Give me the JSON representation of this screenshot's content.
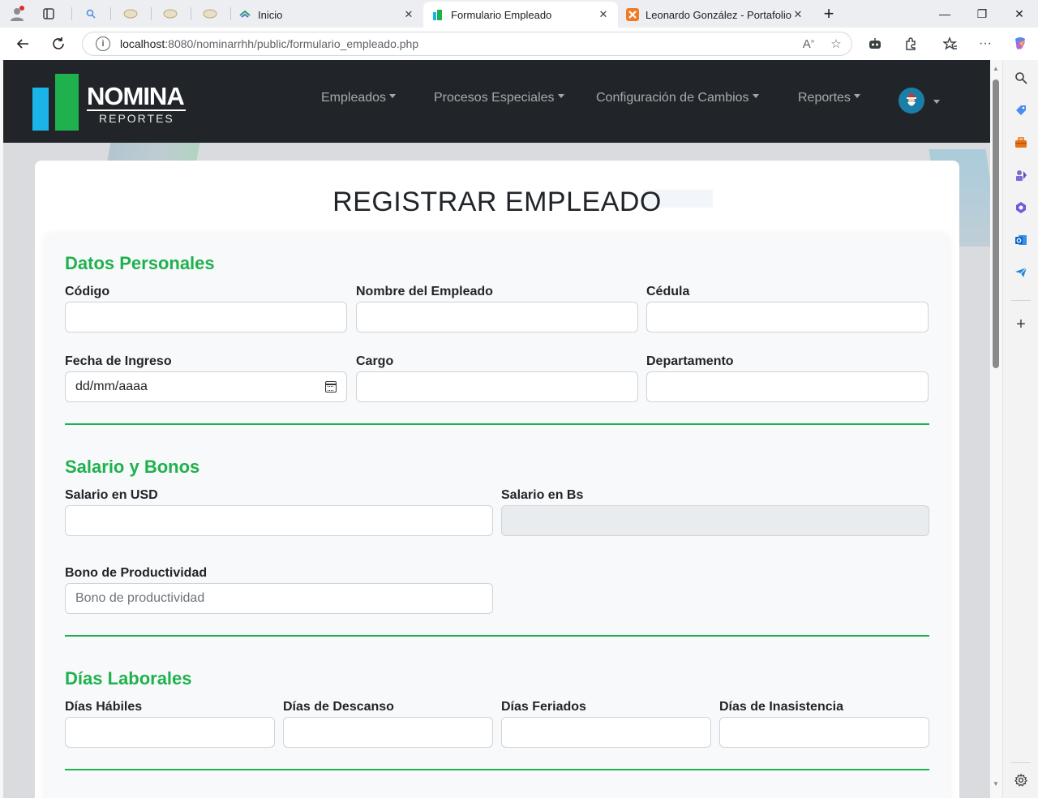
{
  "browser": {
    "tabs": [
      {
        "title": "Inicio",
        "active": false
      },
      {
        "title": "Formulario Empleado",
        "active": true
      },
      {
        "title": "Leonardo González - Portafolio",
        "active": false
      }
    ],
    "new_tab": "+",
    "url_host": "localhost",
    "url_rest": ":8080/nominarrhh/public/formulario_empleado.php",
    "window_controls": {
      "minimize": "—",
      "restore": "❐",
      "close": "✕"
    }
  },
  "navbar": {
    "logo_title": "NOMINA",
    "logo_subtitle": "REPORTES",
    "items": [
      {
        "label": "Empleados"
      },
      {
        "label": "Procesos Especiales"
      },
      {
        "label": "Configuración de Cambios"
      },
      {
        "label": "Reportes"
      }
    ]
  },
  "form": {
    "title": "REGISTRAR EMPLEADO",
    "sections": {
      "personal": {
        "title": "Datos Personales",
        "codigo": "Código",
        "nombre": "Nombre del Empleado",
        "cedula": "Cédula",
        "fecha": "Fecha de Ingreso",
        "fecha_placeholder": "dd/mm/aaaa",
        "cargo": "Cargo",
        "departamento": "Departamento"
      },
      "salario": {
        "title": "Salario y Bonos",
        "usd": "Salario en USD",
        "bs": "Salario en Bs",
        "bono": "Bono de Productividad",
        "bono_placeholder": "Bono de productividad"
      },
      "dias": {
        "title": "Días Laborales",
        "habiles": "Días Hábiles",
        "descanso": "Días de Descanso",
        "feriados": "Días Feriados",
        "inasistencia": "Días de Inasistencia"
      }
    }
  },
  "colors": {
    "accent": "#1fb14d",
    "navbar_bg": "#212529",
    "logo_blue": "#1ab4e8"
  }
}
